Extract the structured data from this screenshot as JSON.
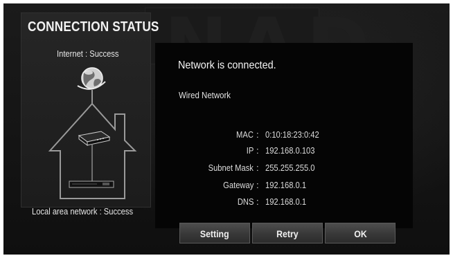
{
  "watermark": "NAD",
  "header": {
    "title": "CONNECTION STATUS"
  },
  "left_panel": {
    "internet_status": "Internet : Success",
    "local_status": "Local area network : Success"
  },
  "main": {
    "headline": "Network is connected.",
    "network_type": "Wired Network",
    "info": [
      {
        "label": "MAC",
        "value": "0:10:18:23:0:42"
      },
      {
        "label": "IP",
        "value": "192.168.0.103"
      },
      {
        "label": "Subnet Mask",
        "value": "255.255.255.0"
      },
      {
        "label": "Gateway",
        "value": "192.168.0.1"
      },
      {
        "label": "DNS",
        "value": "192.168.0.1"
      }
    ]
  },
  "buttons": {
    "setting": "Setting",
    "retry": "Retry",
    "ok": "OK"
  },
  "icons": [
    "globe-icon",
    "router-icon",
    "house-icon",
    "player-device-icon"
  ],
  "colors": {
    "background": "#141414",
    "panel": "#050505",
    "text": "#f2f2f2",
    "button": "#3a3a3a"
  }
}
